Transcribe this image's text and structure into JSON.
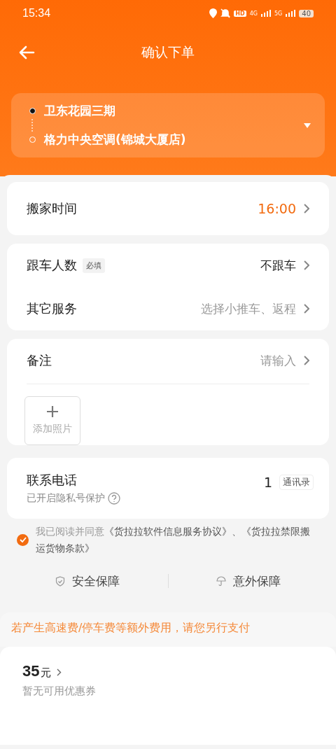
{
  "status_bar": {
    "time": "15:34",
    "hd": "HD",
    "net_1": "4G",
    "net_2": "5G",
    "battery": "40"
  },
  "header": {
    "title": "确认下单"
  },
  "route": {
    "stops": [
      {
        "name": "卫东花园三期",
        "kind": "start"
      },
      {
        "name": "格力中央空调(锦城大厦店)",
        "kind": "end"
      }
    ]
  },
  "move_time": {
    "label": "搬家时间",
    "value": "16:00"
  },
  "options": [
    {
      "label": "跟车人数",
      "tag": "必填",
      "value": "不跟车",
      "placeholder": false
    },
    {
      "label": "其它服务",
      "value": "选择小推车、返程",
      "placeholder": true
    }
  ],
  "remarks": {
    "label": "备注",
    "placeholder": "请输入",
    "add_photo": "添加照片"
  },
  "contact": {
    "label": "联系电话",
    "note": "已开启隐私号保护",
    "phone": "1",
    "contacts_button": "通讯录"
  },
  "agreement": {
    "checked": true,
    "text": "我已阅读并同意",
    "links": "《货拉拉软件信息服务协议》、《货拉拉禁限搬运货物条款》"
  },
  "guarantees": [
    {
      "label": "安全保障",
      "kind": "shield"
    },
    {
      "label": "意外保障",
      "kind": "umbrella"
    }
  ],
  "notice": "若产生高速费/停车费等额外费用，请您另行支付",
  "price": {
    "amount": "35",
    "unit": "元",
    "coupon": "暂无可用优惠券"
  }
}
